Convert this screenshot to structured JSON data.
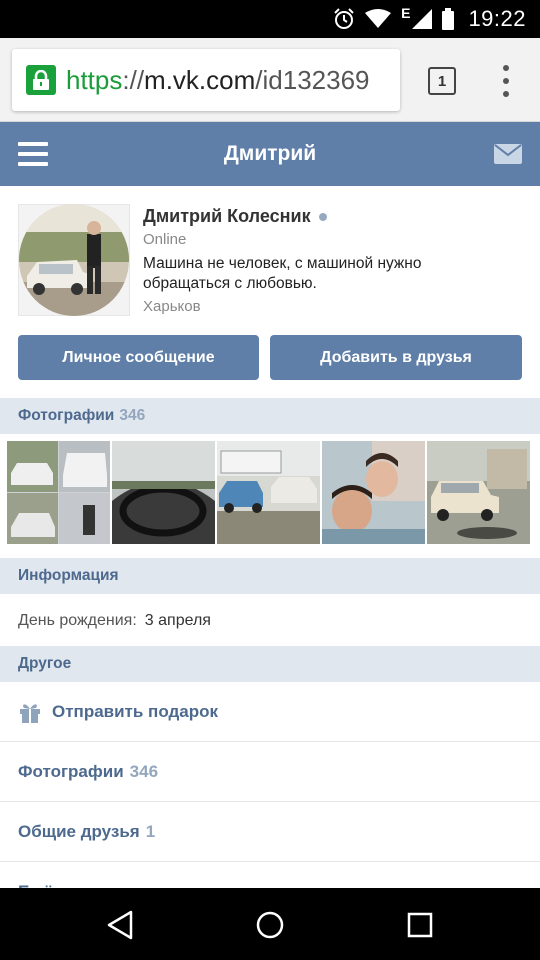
{
  "status_bar": {
    "time": "19:22",
    "network_letter": "E",
    "icons": [
      "alarm-icon",
      "wifi-icon",
      "signal-icon",
      "battery-icon"
    ]
  },
  "browser": {
    "url_scheme": "https",
    "url_sep": "://",
    "url_host": "m.vk.com",
    "url_path": "/id132369",
    "tab_count": "1",
    "accent": "#1a9c3a"
  },
  "header": {
    "title": "Дмитрий",
    "bg_color": "#5f7fa8"
  },
  "profile": {
    "name": "Дмитрий Колесник",
    "status": "Online",
    "quote": "Машина не человек, с машиной нужно обращаться с любовью.",
    "city": "Харьков",
    "buttons": {
      "message": "Личное сообщение",
      "add_friend": "Добавить в друзья"
    }
  },
  "photos": {
    "title": "Фотографии",
    "count": "346"
  },
  "info": {
    "title": "Информация",
    "birthday_label": "День рождения:",
    "birthday_value": "3 апреля"
  },
  "other": {
    "title": "Другое",
    "gift_label": "Отправить подарок",
    "photos_label": "Фотографии",
    "photos_count": "346",
    "friends_label": "Общие друзья",
    "friends_count": "1",
    "more_label": "Ещё"
  }
}
